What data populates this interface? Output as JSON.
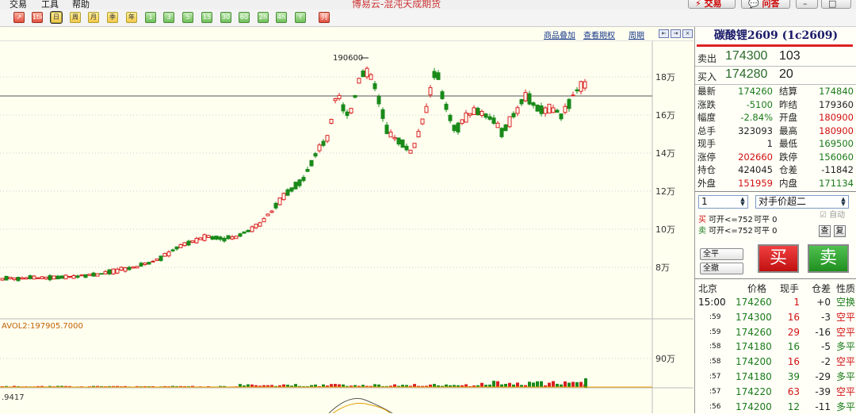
{
  "menu": {
    "items": [
      "交易",
      "工具",
      "帮助"
    ],
    "title": "博易云-混沌天成期货",
    "trade_btn": "交易",
    "ask_btn": "问答"
  },
  "toolbar": {
    "buttons": [
      "1tick",
      "日",
      "周",
      "月",
      "季",
      "年",
      "1",
      "3",
      "5",
      "15",
      "30",
      "60",
      "2h",
      "4h",
      "Y",
      "列"
    ]
  },
  "chartbar": {
    "links": [
      "商品叠加",
      "查看期权",
      "周期"
    ]
  },
  "chart_data": {
    "type": "candlestick",
    "y_ticks": [
      "18万",
      "16万",
      "14万",
      "12万",
      "10万",
      "8万"
    ],
    "y_values": [
      180000,
      160000,
      140000,
      120000,
      100000,
      80000
    ],
    "peak_label": "190600",
    "peak_value": 190600,
    "volume_label": "AVOL2:197905.7000",
    "volume_tick": "90万",
    "bottom_label": ".9417",
    "reference_price": 175500
  },
  "panel": {
    "title": "碳酸锂2609 (1c2609)",
    "ask_label": "卖出",
    "ask_price": "174300",
    "ask_vol": "103",
    "bid_label": "买入",
    "bid_price": "174280",
    "bid_vol": "20",
    "stats": [
      {
        "l": "最新",
        "v": "174260",
        "c": "green",
        "l2": "结算",
        "v2": "174840",
        "c2": "green"
      },
      {
        "l": "涨跌",
        "v": "-5100",
        "c": "green",
        "l2": "昨结",
        "v2": "179360",
        "c2": "blk"
      },
      {
        "l": "幅度",
        "v": "-2.84%",
        "c": "green",
        "l2": "开盘",
        "v2": "180900",
        "c2": "red"
      },
      {
        "l": "总手",
        "v": "323093",
        "c": "blk",
        "l2": "最高",
        "v2": "180900",
        "c2": "red"
      },
      {
        "l": "现手",
        "v": "1",
        "c": "blk",
        "l2": "最低",
        "v2": "169500",
        "c2": "green"
      },
      {
        "l": "涨停",
        "v": "202660",
        "c": "red",
        "l2": "跌停",
        "v2": "156060",
        "c2": "green"
      },
      {
        "l": "持仓",
        "v": "424045",
        "c": "blk",
        "l2": "仓差",
        "v2": "-11842",
        "c2": "blk"
      },
      {
        "l": "外盘",
        "v": "151959",
        "c": "red",
        "l2": "内盘",
        "v2": "171134",
        "c2": "green"
      }
    ],
    "qty": "1",
    "price_mode": "对手价超二",
    "auto": "自动",
    "buy_open": "可开<=752",
    "buy_close": "可平 0",
    "sell_open": "可开<=752",
    "sell_close": "可平 0",
    "buy_tag": "买",
    "sell_tag": "卖",
    "query_btn": "查",
    "copy_btn": "复",
    "close_all": "全平",
    "cancel_all": "全撤",
    "buy_btn": "买",
    "sell_btn": "卖",
    "tick_head": [
      "北京",
      "价格",
      "现手",
      "仓差",
      "性质"
    ],
    "ticks": [
      {
        "t": "15:00",
        "p": "174260",
        "q": "1",
        "d": "+0",
        "n": "空换",
        "qc": "red",
        "dc": "blk",
        "nc": "green"
      },
      {
        "t": ":59",
        "p": "174300",
        "q": "16",
        "d": "-3",
        "n": "空平",
        "qc": "red",
        "dc": "blk",
        "nc": "red"
      },
      {
        "t": ":59",
        "p": "174260",
        "q": "29",
        "d": "-16",
        "n": "空平",
        "qc": "red",
        "dc": "blk",
        "nc": "red"
      },
      {
        "t": ":58",
        "p": "174180",
        "q": "16",
        "d": "-5",
        "n": "多平",
        "qc": "green",
        "dc": "blk",
        "nc": "green"
      },
      {
        "t": ":58",
        "p": "174200",
        "q": "16",
        "d": "-2",
        "n": "空平",
        "qc": "red",
        "dc": "blk",
        "nc": "red"
      },
      {
        "t": ":57",
        "p": "174180",
        "q": "39",
        "d": "-29",
        "n": "多平",
        "qc": "green",
        "dc": "blk",
        "nc": "green"
      },
      {
        "t": ":57",
        "p": "174220",
        "q": "63",
        "d": "-39",
        "n": "空平",
        "qc": "red",
        "dc": "blk",
        "nc": "red"
      },
      {
        "t": ":56",
        "p": "174200",
        "q": "12",
        "d": "-11",
        "n": "多平",
        "qc": "green",
        "dc": "blk",
        "nc": "green"
      }
    ]
  }
}
